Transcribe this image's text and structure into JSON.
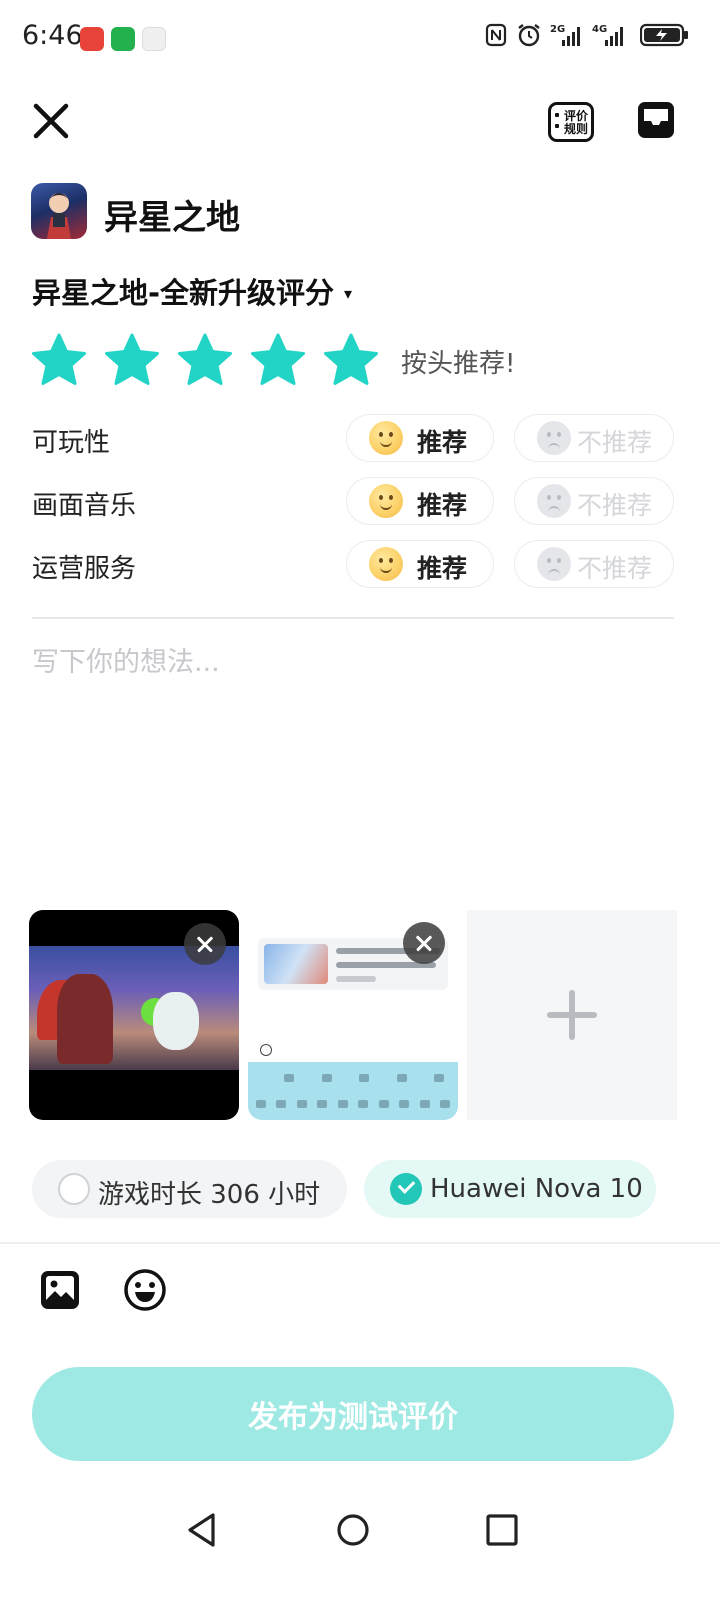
{
  "status_bar": {
    "time": "6:46",
    "notification_icons": [
      "huawei-app-icon",
      "wechat-icon",
      "app-icon"
    ],
    "system_icons": [
      "nfc-icon",
      "alarm-icon",
      "signal-2g-icon",
      "signal-4g-icon",
      "battery-icon"
    ]
  },
  "header": {
    "close_icon": "close-icon",
    "rules_label": "评价规则",
    "draft_icon": "draft-box-icon"
  },
  "game": {
    "name": "异星之地",
    "icon": "game-icon"
  },
  "version": {
    "label": "异星之地-全新升级评分",
    "caret": "▾"
  },
  "rating": {
    "stars": 5,
    "max_stars": 5,
    "text": "按头推荐!",
    "star_color": "#22d4c6"
  },
  "aspects": [
    {
      "label": "可玩性",
      "recommend": "推荐",
      "not_recommend": "不推荐",
      "selected": "recommend"
    },
    {
      "label": "画面音乐",
      "recommend": "推荐",
      "not_recommend": "不推荐",
      "selected": "recommend"
    },
    {
      "label": "运营服务",
      "recommend": "推荐",
      "not_recommend": "不推荐",
      "selected": "recommend"
    }
  ],
  "thoughts": {
    "placeholder": "写下你的想法...",
    "value": ""
  },
  "media": {
    "thumb2_title": "【异星之地】利刃破晓卡…",
    "thumb2_line2": "转发赢豪礼三件套（价值…",
    "thumb2_source": "@异星之地",
    "thumb2_keyboard_row1": [
      "我",
      "你",
      "谢谢",
      "不"
    ],
    "thumb2_keyboard_row2": [
      "q",
      "w",
      "e",
      "r",
      "t",
      "y",
      "u",
      "i",
      "o",
      "p"
    ]
  },
  "tags": {
    "playtime": "游戏时长 306 小时",
    "playtime_checked": false,
    "device": "Huawei Nova 10",
    "device_checked": true
  },
  "toolbar": {
    "image_icon": "image-icon",
    "emoji_icon": "emoji-icon"
  },
  "publish": {
    "label": "发布为测试评价",
    "color": "#9ee9e4"
  },
  "nav_bar": {
    "icons": [
      "back-icon",
      "home-icon",
      "recents-icon"
    ]
  }
}
